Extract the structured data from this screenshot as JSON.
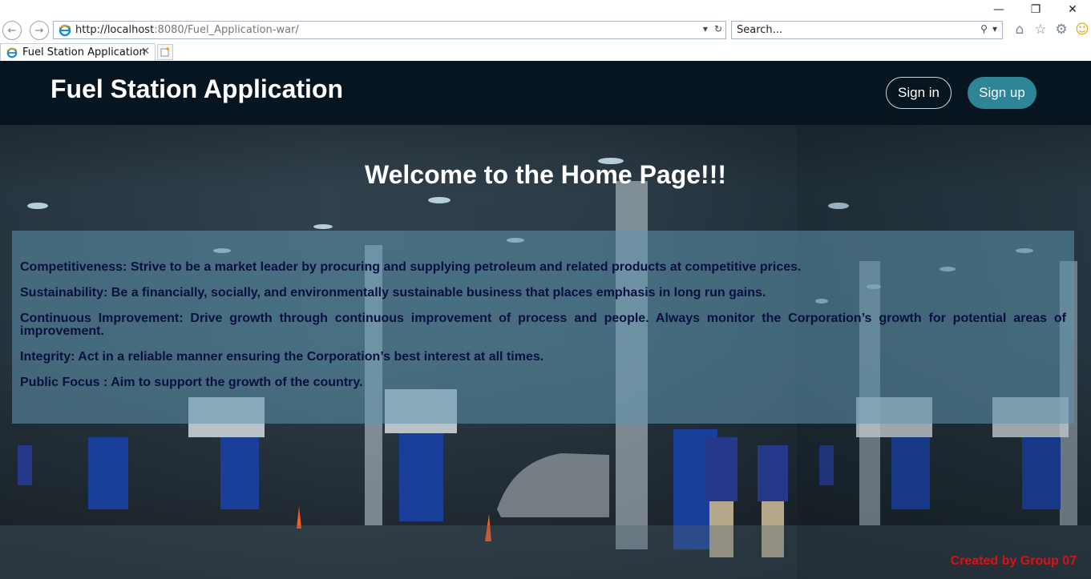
{
  "browser": {
    "address_host": "http://localhost",
    "address_rest": ":8080/Fuel_Application-war/",
    "search_placeholder": "Search...",
    "tab_title": "Fuel Station Application",
    "window_controls": [
      "minimize-icon",
      "restore-icon",
      "close-icon"
    ],
    "toolbar_icons": [
      "home-icon",
      "star-icon",
      "gear-icon",
      "smiley-icon"
    ]
  },
  "header": {
    "brand": "Fuel Station Application",
    "signin_label": "Sign in",
    "signup_label": "Sign up",
    "colors": {
      "navbar": "#071520",
      "signup_bg": "#2e8596"
    }
  },
  "main": {
    "title": "Welcome to the Home Page!!!",
    "values": [
      "Competitiveness: Strive to be a market leader by procuring and supplying petroleum and related products at competitive prices.",
      "Sustainability: Be a financially, socially, and environmentally sustainable business that places emphasis in long run gains.",
      "Continuous Improvement: Drive growth through continuous improvement of process and people. Always monitor the Corporation’s growth for potential areas of improvement.",
      "Integrity: Act in a reliable manner ensuring the Corporation’s best interest at all times.",
      "Public Focus : Aim to support the growth of the country."
    ]
  },
  "footer": {
    "credit": "Created by Group 07",
    "credit_color": "#e01010"
  }
}
